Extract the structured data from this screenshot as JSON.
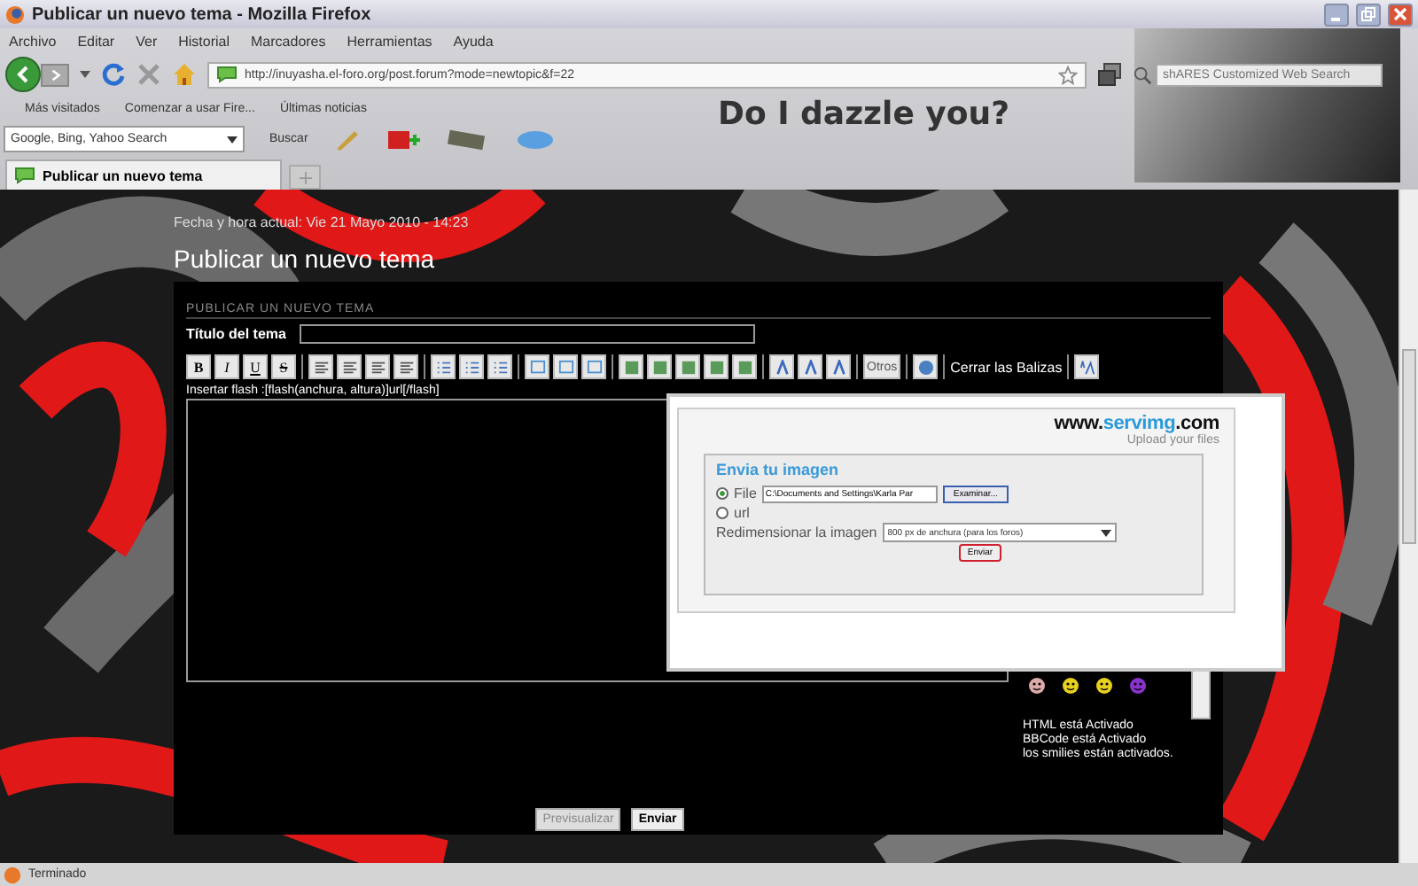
{
  "window": {
    "title": "Publicar un nuevo tema - Mozilla Firefox"
  },
  "menu": [
    "Archivo",
    "Editar",
    "Ver",
    "Historial",
    "Marcadores",
    "Herramientas",
    "Ayuda"
  ],
  "address_bar": {
    "value": "http://inuyasha.el-foro.org/post.forum?mode=newtopic&f=22"
  },
  "web_search": {
    "placeholder": "shARES Customized Web Search"
  },
  "bookmarks": [
    "Más visitados",
    "Comenzar a usar Fire...",
    "Últimas noticias"
  ],
  "search_toolbar": {
    "engine": "Google, Bing, Yahoo Search",
    "button": "Buscar"
  },
  "banner": {
    "text": "Do I dazzle you?"
  },
  "tabs": [
    {
      "label": "Publicar un nuevo tema",
      "selected": true
    }
  ],
  "page": {
    "datetime": "Fecha y hora actual: Vie 21 Mayo 2010 - 14:23",
    "heading": "Publicar un nuevo tema"
  },
  "form": {
    "section_title": "PUBLICAR UN NUEVO TEMA",
    "title_label": "Título del tema",
    "format_buttons": [
      "B",
      "I",
      "U",
      "S"
    ],
    "others_button": "Otros",
    "close_tags": "Cerrar las Balizas",
    "flash_hint": "Insertar flash :[flash(anchura, altura)]url[/flash]",
    "status_lines": [
      "HTML está Activado",
      "BBCode está Activado",
      "los smilies están activados."
    ],
    "buttons": [
      {
        "label": "Previsualizar",
        "primary": false
      },
      {
        "label": "Enviar",
        "primary": true
      }
    ]
  },
  "upload_dialog": {
    "logo": {
      "prefix": "www.",
      "name": "servimg",
      "suffix": ".com"
    },
    "tagline": "Upload your files",
    "heading": "Envia tu imagen",
    "sources": [
      {
        "label": "File",
        "selected": true
      },
      {
        "label": "url",
        "selected": false
      }
    ],
    "file_value": "C:\\Documents and Settings\\Karla Par",
    "browse_button": "Examinar...",
    "resize_label": "Redimensionar la imagen",
    "resize_value": "800 px de anchura (para los foros)",
    "submit": "Enviar"
  },
  "status_bar": {
    "text": "Terminado"
  }
}
